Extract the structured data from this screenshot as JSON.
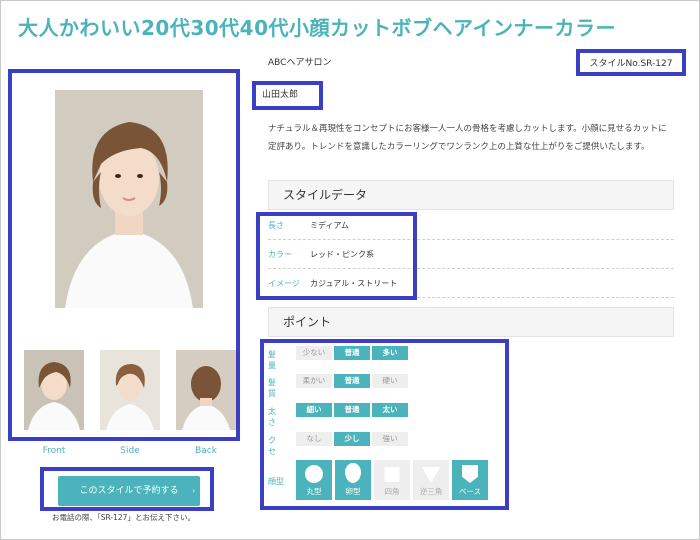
{
  "page_title": "大人かわいい20代30代40代小顔カットボブヘアインナーカラー",
  "salon_name": "ABCヘアサロン",
  "style_number": "スタイルNo.SR-127",
  "stylist_name": "山田太郎",
  "description": "ナチュラル＆再現性をコンセプトにお客様一人一人の骨格を考慮しカットします。小顔に見せるカットに定評あり。トレンドを意識したカラーリングでワンランク上の上質な仕上がりをご提供いたします。",
  "style_data": {
    "heading": "スタイルデータ",
    "rows": [
      {
        "key": "長さ",
        "value": "ミディアム"
      },
      {
        "key": "カラー",
        "value": "レッド・ピンク系"
      },
      {
        "key": "イメージ",
        "value": "カジュアル・ストリート"
      }
    ]
  },
  "points": {
    "heading": "ポイント",
    "rows": [
      {
        "key": "髪量",
        "options": [
          "少ない",
          "普通",
          "多い"
        ],
        "selected": [
          "普通",
          "多い"
        ]
      },
      {
        "key": "髪質",
        "options": [
          "柔かい",
          "普通",
          "硬い"
        ],
        "selected": [
          "普通"
        ]
      },
      {
        "key": "太さ",
        "options": [
          "細い",
          "普通",
          "太い"
        ],
        "selected": [
          "細い",
          "普通",
          "太い"
        ]
      },
      {
        "key": "クセ",
        "options": [
          "なし",
          "少し",
          "強い"
        ],
        "selected": [
          "少し"
        ]
      }
    ],
    "face_shape_key": "顔型",
    "face_shapes": [
      {
        "label": "丸型",
        "icon": "circle-icon",
        "on": true
      },
      {
        "label": "卵型",
        "icon": "egg-icon",
        "on": true
      },
      {
        "label": "四角",
        "icon": "square-icon",
        "on": false
      },
      {
        "label": "逆三角",
        "icon": "triangle-icon",
        "on": false
      },
      {
        "label": "ベース",
        "icon": "base-icon",
        "on": true
      }
    ]
  },
  "thumbnails": [
    {
      "label": "Front"
    },
    {
      "label": "Side"
    },
    {
      "label": "Back"
    }
  ],
  "reserve_button": "このスタイルで予約する",
  "reserve_note": "お電話の際、「SR-127」とお伝え下さい。",
  "colors": {
    "accent": "#4ab3bb",
    "highlight": "#3b3fc4"
  }
}
